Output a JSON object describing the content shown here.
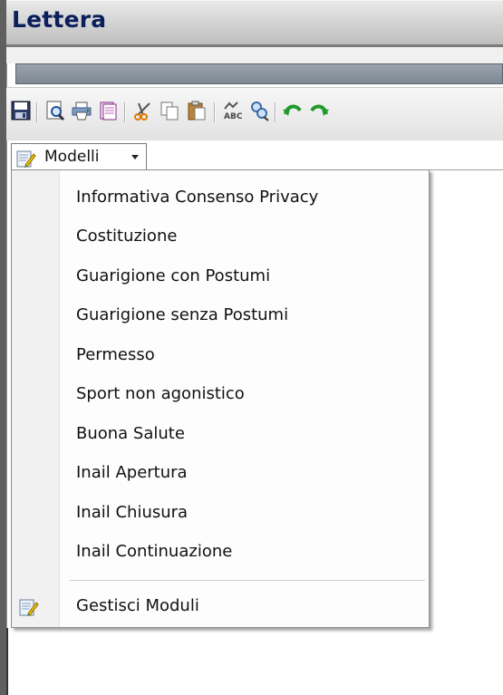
{
  "window": {
    "title": "Lettera"
  },
  "toolbar": {
    "icons": [
      "save-icon",
      "print-preview-icon",
      "print-icon",
      "document-icon",
      "cut-icon",
      "copy-icon",
      "paste-icon",
      "spellcheck-icon",
      "find-replace-icon",
      "undo-icon",
      "redo-icon"
    ]
  },
  "modelli": {
    "label": "Modelli"
  },
  "menu": {
    "items": [
      {
        "label": "Informativa Consenso Privacy"
      },
      {
        "label": "Costituzione"
      },
      {
        "label": "Guarigione con Postumi"
      },
      {
        "label": "Guarigione senza Postumi"
      },
      {
        "label": "Permesso"
      },
      {
        "label": "Sport non agonistico"
      },
      {
        "label": "Buona Salute"
      },
      {
        "label": "Inail Apertura"
      },
      {
        "label": "Inail Chiusura"
      },
      {
        "label": "Inail Continuazione"
      }
    ],
    "manage": {
      "label": "Gestisci Moduli"
    }
  },
  "colors": {
    "title_text": "#0b1f5c",
    "progress_bar": "#8a939d",
    "undo_green": "#1f9b2b"
  }
}
